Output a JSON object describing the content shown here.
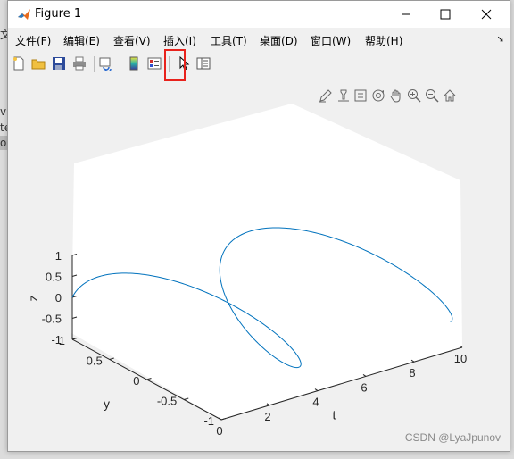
{
  "background": {
    "fragments": [
      "文",
      "v",
      "te",
      "o"
    ]
  },
  "window": {
    "title": "Figure 1"
  },
  "menu": [
    {
      "label": "文件(F)"
    },
    {
      "label": "编辑(E)"
    },
    {
      "label": "查看(V)"
    },
    {
      "label": "插入(I)"
    },
    {
      "label": "工具(T)"
    },
    {
      "label": "桌面(D)"
    },
    {
      "label": "窗口(W)"
    },
    {
      "label": "帮助(H)"
    }
  ],
  "toolbar": [
    "new-figure-icon",
    "open-file-icon",
    "save-icon",
    "print-icon",
    "link-plot-icon",
    "insert-colorbar-icon",
    "insert-legend-icon",
    "edit-plot-pointer-icon",
    "open-property-inspector-icon"
  ],
  "axes_toolbar": [
    "brush-icon",
    "data-tips-icon",
    "rotate-3d-icon",
    "pan-icon",
    "zoom-in-icon",
    "zoom-out-icon",
    "home-icon"
  ],
  "chart_data": {
    "type": "line",
    "projection": "3d",
    "title": "",
    "xlabel": "t",
    "ylabel": "y",
    "zlabel": "z",
    "xlim": [
      0,
      10
    ],
    "ylim": [
      -1,
      1
    ],
    "zlim": [
      -1,
      1
    ],
    "xticks": [
      "0",
      "2",
      "4",
      "6",
      "8",
      "10"
    ],
    "yticks": [
      "-1",
      "-0.5",
      "0",
      "0.5",
      "1"
    ],
    "zticks": [
      "-1",
      "-0.5",
      "0",
      "0.5",
      "1"
    ],
    "color": "#0072BD",
    "series": [
      {
        "x_expr": "t, 0 ≤ t ≤ 10",
        "y_expr": "cos(t)",
        "z_expr": "sin(t)"
      }
    ]
  },
  "watermark": "CSDN @LyaJpunov"
}
